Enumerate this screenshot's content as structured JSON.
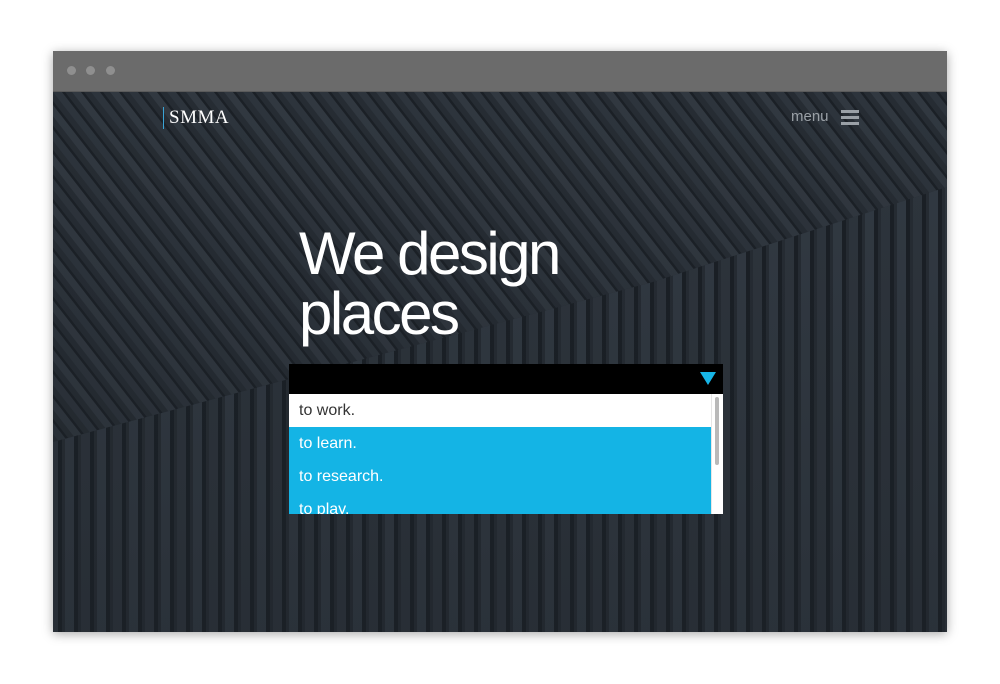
{
  "window": {
    "controls": [
      "window-dot-1",
      "window-dot-2",
      "window-dot-3"
    ]
  },
  "header": {
    "logo_text": "SMMA",
    "menu_label": "menu",
    "menu_icon": "hamburger-icon"
  },
  "hero": {
    "headline_line1": "We design",
    "headline_line2": "places"
  },
  "select": {
    "selected_value": "",
    "arrow_icon": "chevron-down-icon",
    "options": [
      "to work.",
      "to learn.",
      "to research.",
      "to play."
    ],
    "highlighted": [
      "to learn.",
      "to research.",
      "to play."
    ]
  },
  "colors": {
    "accent": "#14b4e5",
    "background": "#262c33",
    "chrome": "#6b6b6b"
  }
}
